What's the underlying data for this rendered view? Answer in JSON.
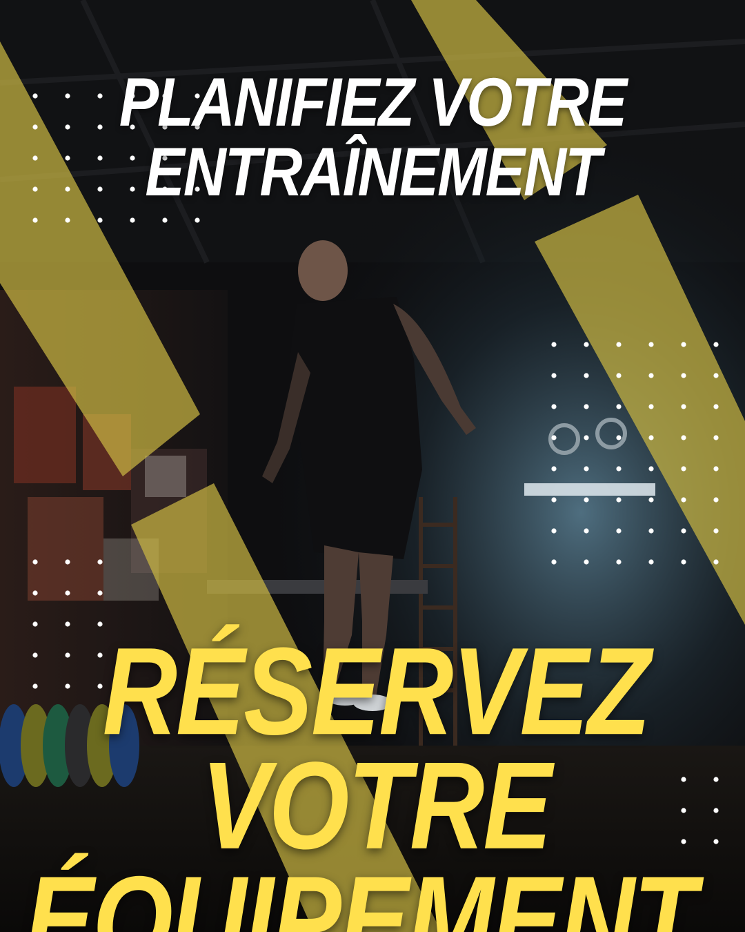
{
  "headline_top": {
    "line1": "PLANIFIEZ VOTRE",
    "line2": "ENTRAÎNEMENT"
  },
  "headline_bottom": {
    "line1": "RÉSERVEZ VOTRE",
    "line2": "ÉQUIPEMENT"
  },
  "colors": {
    "accent_yellow": "#ffe04d",
    "stripe_olive": "#b6a53e",
    "text_white": "#ffffff",
    "background_dark": "#0b0b0c"
  },
  "icons": [
    "dot-grid-decoration"
  ]
}
